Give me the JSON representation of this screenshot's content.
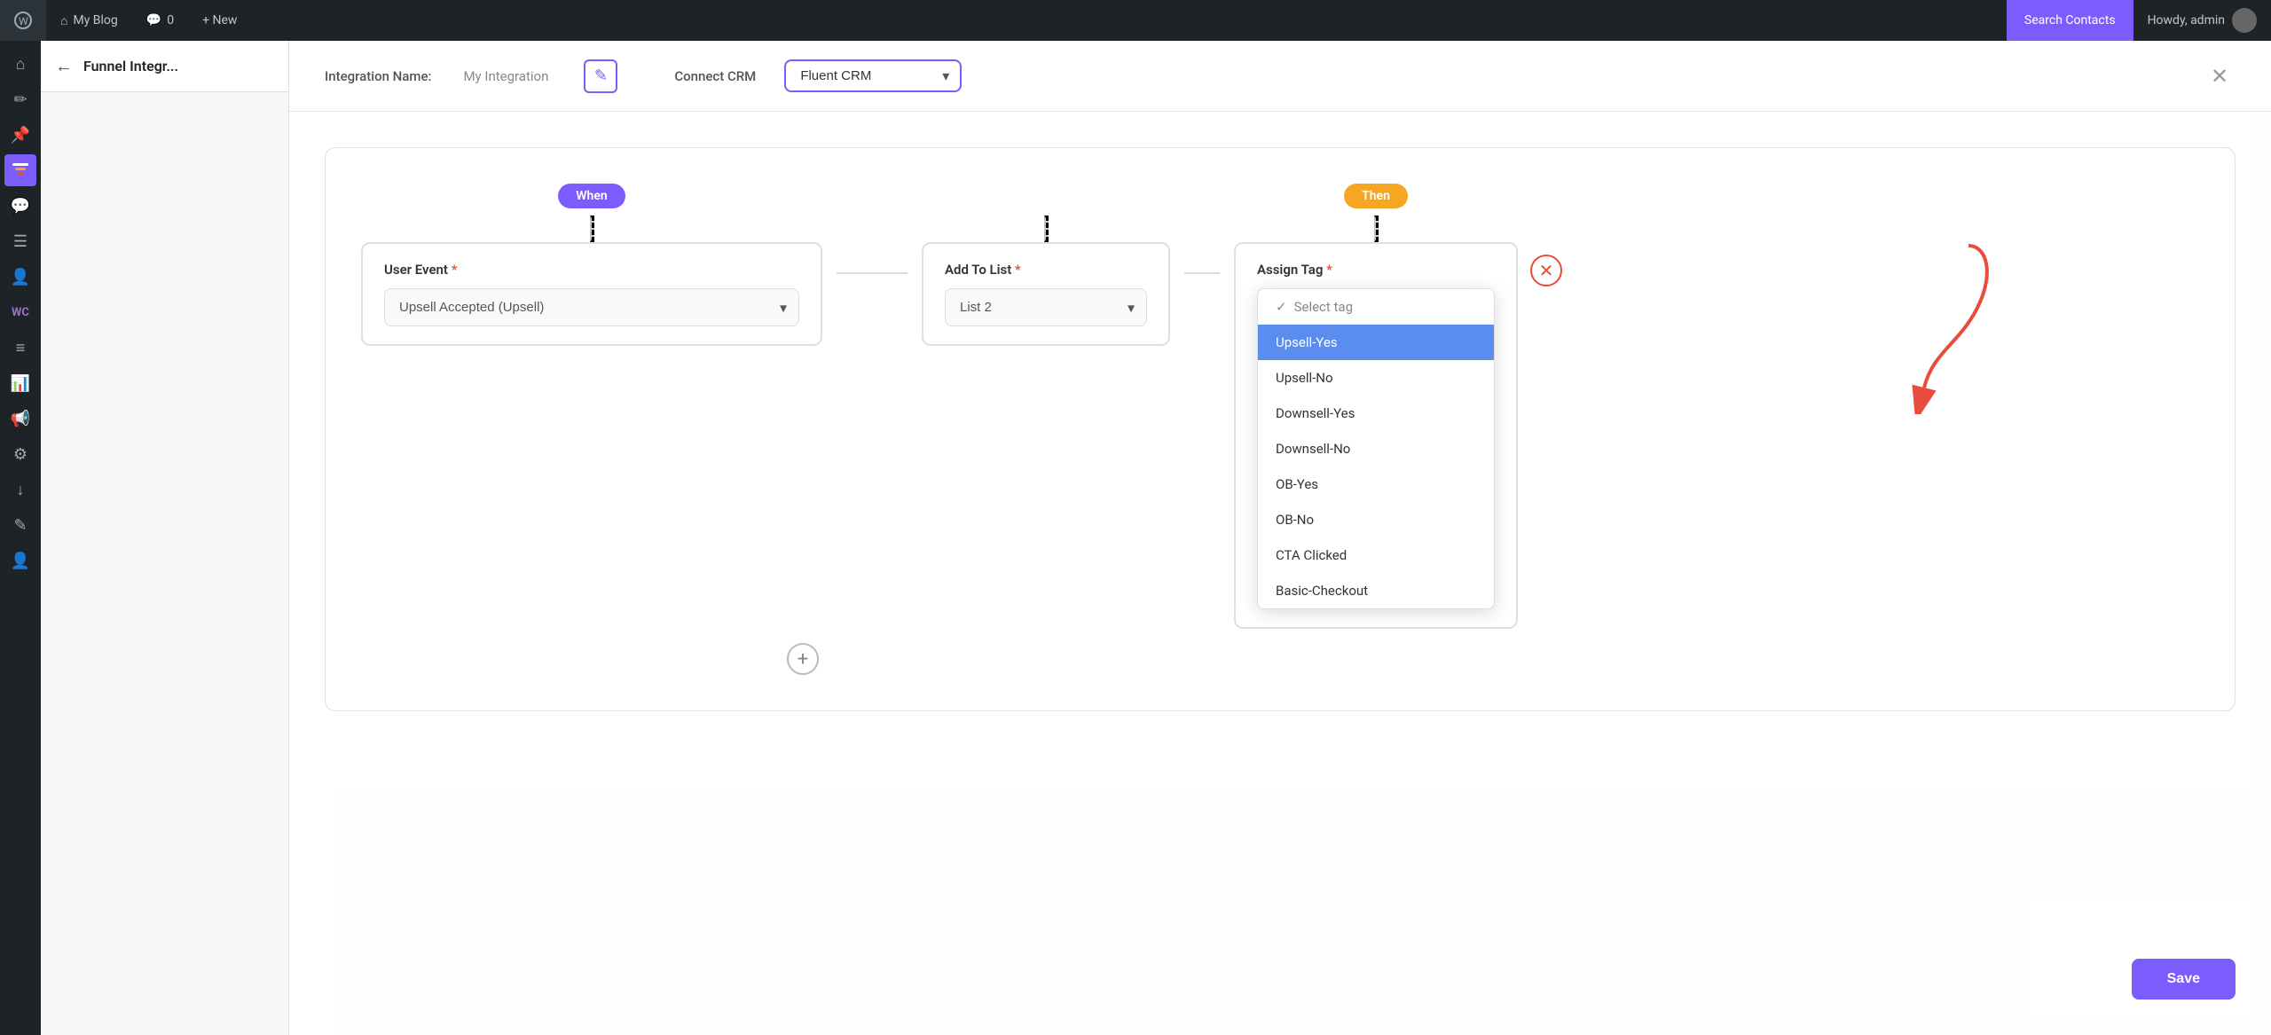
{
  "adminBar": {
    "wpLogoLabel": "W",
    "myBlogLabel": "My Blog",
    "commentsLabel": "0",
    "newLabel": "+ New",
    "searchContactsLabel": "Search Contacts",
    "howdyLabel": "Howdy, admin"
  },
  "sidebar": {
    "icons": [
      "⌂",
      "✏",
      "📌",
      "—",
      "💬",
      "☰",
      "☻",
      "WC",
      "≡",
      "📊",
      "📢",
      "≡",
      "↓",
      "✎",
      "👤"
    ]
  },
  "secondSidebar": {
    "backLabel": "←",
    "title": "Funnel Integr..."
  },
  "modal": {
    "integrationNameLabel": "Integration Name:",
    "integrationNameValue": "My Integration",
    "editIconLabel": "✎",
    "connectCRMLabel": "Connect CRM",
    "crmValue": "Fluent CRM",
    "closeLabel": "✕"
  },
  "flow": {
    "whenBadge": "When",
    "thenBadge": "Then",
    "userEventLabel": "User Event",
    "userEventRequired": "*",
    "userEventValue": "Upsell Accepted (Upsell)",
    "addToListLabel": "Add To List",
    "addToListRequired": "*",
    "addToListValue": "List 2",
    "assignTagLabel": "Assign Tag",
    "assignTagRequired": "*"
  },
  "tagDropdown": {
    "placeholder": "Select tag",
    "items": [
      {
        "label": "Select tag",
        "type": "placeholder",
        "checked": true
      },
      {
        "label": "Upsell-Yes",
        "type": "selected"
      },
      {
        "label": "Upsell-No",
        "type": "normal"
      },
      {
        "label": "Downsell-Yes",
        "type": "normal"
      },
      {
        "label": "Downsell-No",
        "type": "normal"
      },
      {
        "label": "OB-Yes",
        "type": "normal"
      },
      {
        "label": "OB-No",
        "type": "normal"
      },
      {
        "label": "CTA Clicked",
        "type": "normal"
      },
      {
        "label": "Basic-Checkout",
        "type": "normal"
      }
    ]
  },
  "saveButton": "Save",
  "plusButton": "+",
  "colors": {
    "primary": "#7c5cfc",
    "orange": "#f5a623",
    "selected": "#5b8def",
    "danger": "#e74c3c"
  }
}
